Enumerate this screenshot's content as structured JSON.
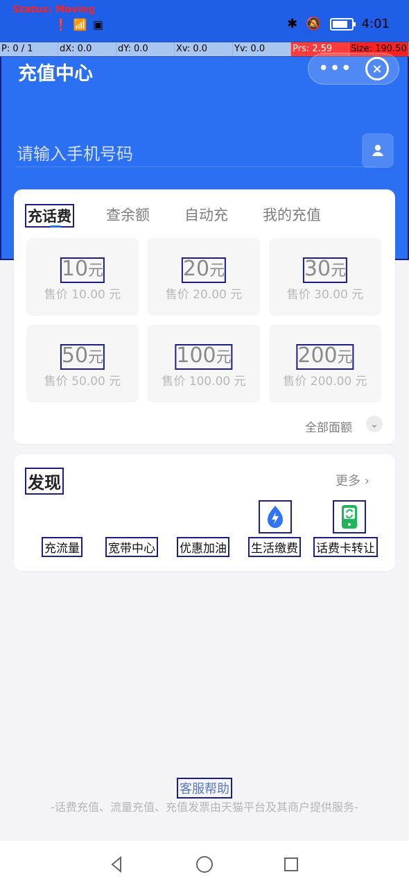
{
  "debug": {
    "status": "Status: Moving",
    "metrics": [
      {
        "label": "P: 0 / 1"
      },
      {
        "label": "dX: 0.0"
      },
      {
        "label": "dY: 0.0"
      },
      {
        "label": "Xv: 0.0"
      },
      {
        "label": "Yv: 0.0"
      },
      {
        "label": "Prs: 2.59"
      },
      {
        "label": "Size: 190.50"
      }
    ]
  },
  "status_bar": {
    "time": "4:01"
  },
  "header": {
    "title": "充值中心",
    "more_icon": "more-horizontal-icon",
    "close_icon": "close-circle-icon"
  },
  "phone_input": {
    "placeholder": "请输入手机号码"
  },
  "tabs": [
    {
      "label": "充话费"
    },
    {
      "label": "查余额"
    },
    {
      "label": "自动充"
    },
    {
      "label": "我的充值"
    }
  ],
  "recharge_options": [
    {
      "amount": "10",
      "unit": "元",
      "price": "售价 10.00 元"
    },
    {
      "amount": "20",
      "unit": "元",
      "price": "售价 20.00 元"
    },
    {
      "amount": "30",
      "unit": "元",
      "price": "售价 30.00 元"
    },
    {
      "amount": "50",
      "unit": "元",
      "price": "售价 50.00 元"
    },
    {
      "amount": "100",
      "unit": "元",
      "price": "售价 100.00 元"
    },
    {
      "amount": "200",
      "unit": "元",
      "price": "售价 200.00 元"
    }
  ],
  "recharge_footer": {
    "all_amounts": "全部面额"
  },
  "discover": {
    "title": "发现",
    "more": "更多",
    "features": [
      {
        "label": "充流量",
        "icon": ""
      },
      {
        "label": "宽带中心",
        "icon": ""
      },
      {
        "label": "优惠加油",
        "icon": ""
      },
      {
        "label": "生活缴费",
        "icon": "lightning-drop-icon"
      },
      {
        "label": "话费卡转让",
        "icon": "phone-card-refresh-icon"
      }
    ]
  },
  "footer": {
    "help": "客服帮助",
    "note": "-话费充值、流量充值、充值发票由天猫平台及其商户提供服务-"
  },
  "colors": {
    "primary": "#2b6ff2",
    "status_bar": "#1f5fe8",
    "green_icon": "#22b45d",
    "blue_icon": "#2f74f4"
  }
}
